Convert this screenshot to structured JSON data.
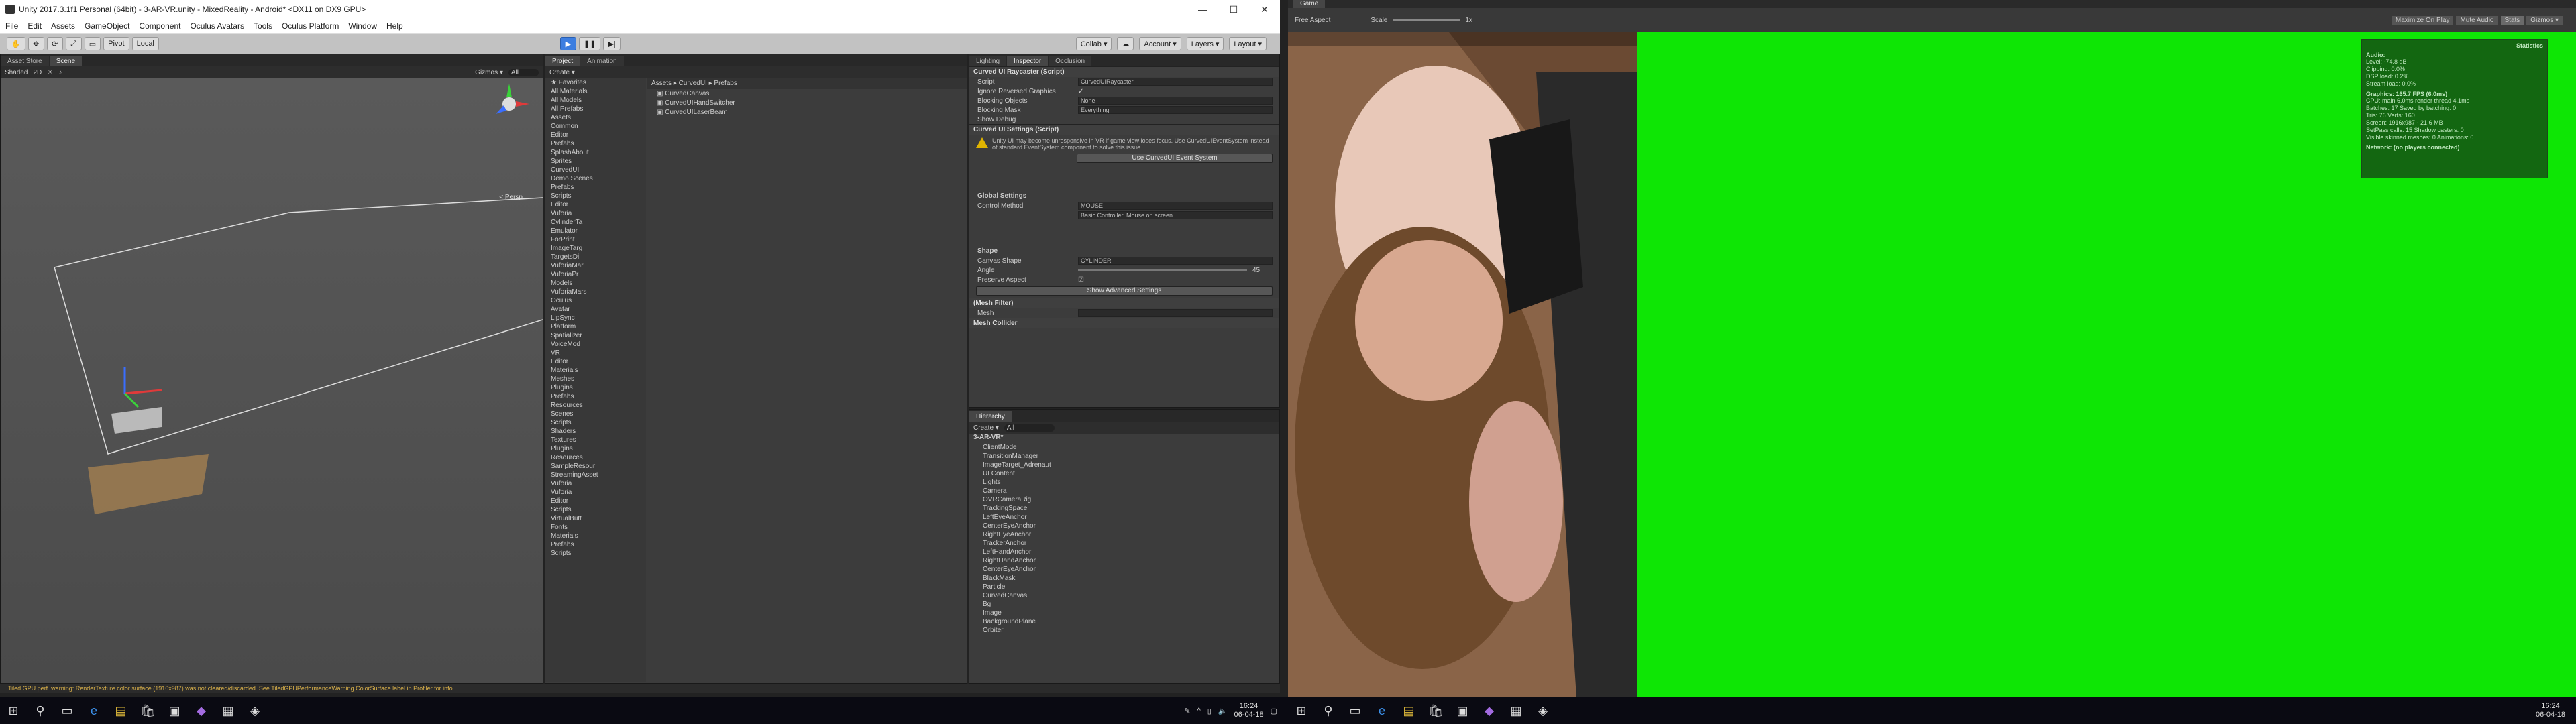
{
  "window": {
    "title": "Unity 2017.3.1f1 Personal (64bit) - 3-AR-VR.unity - MixedReality - Android* <DX11 on DX9 GPU>"
  },
  "menu": [
    "File",
    "Edit",
    "Assets",
    "GameObject",
    "Component",
    "Oculus Avatars",
    "Tools",
    "Oculus Platform",
    "Window",
    "Help"
  ],
  "toolbar": {
    "pivot": "Pivot",
    "local": "Local",
    "collab": "Collab ▾",
    "account": "Account ▾",
    "layers": "Layers ▾",
    "layout": "Layout ▾"
  },
  "scene": {
    "tabs": [
      "Asset Store",
      "Scene"
    ],
    "shading": "Shaded",
    "mode2d": "2D",
    "gizmos": "Gizmos ▾",
    "search": "All",
    "persp": "< Persp"
  },
  "project": {
    "tabs": [
      "Project",
      "Animation"
    ],
    "create": "Create ▾",
    "breadcrumb": "Assets ▸ CurvedUI ▸ Prefabs",
    "tree": [
      "★ Favorites",
      "All Materials",
      "All Models",
      "All Prefabs",
      "Assets",
      "Common",
      "Editor",
      "Prefabs",
      "SplashAbout",
      "Sprites",
      "CurvedUI",
      "Demo Scenes",
      "Prefabs",
      "Scripts",
      "Editor",
      "Vuforia",
      "CylinderTa",
      "Emulator",
      "ForPrint",
      "ImageTarg",
      "TargetsDi",
      "VuforiaMar",
      "VuforiaPr",
      "Models",
      "VuforiaMars",
      "Oculus",
      "Avatar",
      "LipSync",
      "Platform",
      "Spatializer",
      "VoiceMod",
      "VR",
      "Editor",
      "Materials",
      "Meshes",
      "Plugins",
      "Prefabs",
      "Resources",
      "Scenes",
      "Scripts",
      "Shaders",
      "Textures",
      "Plugins",
      "Resources",
      "SampleResour",
      "StreamingAsset",
      "Vuforia",
      "Vuforia",
      "Editor",
      "Scripts",
      "VirtualButt",
      "Fonts",
      "Materials",
      "Prefabs",
      "Scripts"
    ],
    "files": [
      "CurvedCanvas",
      "CurvedUIHandSwitcher",
      "CurvedUILaserBeam"
    ]
  },
  "inspector": {
    "tabs": [
      "Lighting",
      "Inspector",
      "Occlusion"
    ],
    "raycaster": {
      "title": "Curved UI Raycaster (Script)",
      "script_label": "Script",
      "script_val": "CurvedUIRaycaster",
      "props": [
        [
          "Ignore Reversed Graphics",
          "✓"
        ],
        [
          "Blocking Objects",
          "None"
        ],
        [
          "Blocking Mask",
          "Everything"
        ],
        [
          "Show Debug",
          ""
        ]
      ]
    },
    "settings": {
      "title": "Curved UI Settings (Script)",
      "warning": "Unity UI may become unresponsive in VR if game view loses focus. Use CurvedUIEventSystem instead of standard EventSystem component to solve this issue.",
      "use_btn": "Use CurvedUI Event System",
      "global": "Global Settings",
      "control_label": "Control Method",
      "control_val": "MOUSE",
      "control_hint": "Basic Controller. Mouse on screen",
      "shape": "Shape",
      "canvas_shape_label": "Canvas Shape",
      "canvas_shape_val": "CYLINDER",
      "angle_label": "Angle",
      "angle_val": "45",
      "preserve_label": "Preserve Aspect",
      "adv_btn": "Show Advanced Settings"
    },
    "meshfilter": "(Mesh Filter)",
    "mesh_label": "Mesh",
    "meshcollider": "Mesh Collider"
  },
  "hierarchy": {
    "tab": "Hierarchy",
    "create": "Create ▾",
    "search": "All",
    "scene": "3-AR-VR*",
    "items": [
      "ClientMode",
      "TransitionManager",
      "ImageTarget_Adrenaut",
      "UI Content",
      "Lights",
      "Camera",
      "OVRCameraRig",
      "TrackingSpace",
      "LeftEyeAnchor",
      "CenterEyeAnchor",
      "RightEyeAnchor",
      "TrackerAnchor",
      "LeftHandAnchor",
      "RightHandAnchor",
      "CenterEyeAnchor",
      "BlackMask",
      "Particle",
      "CurvedCanvas",
      "Bg",
      "Image",
      "BackgroundPlane",
      "Orbiter"
    ]
  },
  "status": "Tiled GPU perf. warning: RenderTexture color surface (1916x987) was not cleared/discarded. See TiledGPUPerformanceWarning.ColorSurface label in Profiler for info.",
  "taskbar": {
    "time": "16:24",
    "date": "06-04-18"
  },
  "game": {
    "tab": "Game",
    "display": "Free Aspect",
    "scale_label": "Scale",
    "scale_val": "1x",
    "toggles": [
      "Maximize On Play",
      "Mute Audio",
      "Stats",
      "Gizmos ▾"
    ],
    "stats": {
      "title": "Statistics",
      "audio_hd": "Audio:",
      "audio": [
        "Level: -74.8 dB",
        "Clipping: 0.0%",
        "DSP load: 0.2%",
        "Stream load: 0.0%"
      ],
      "graphics_hd": "Graphics:",
      "fps": "165.7 FPS (6.0ms)",
      "graphics": [
        "CPU: main 6.0ms  render thread 4.1ms",
        "Batches: 17   Saved by batching: 0",
        "Tris: 76   Verts: 160",
        "Screen: 1916x987 - 21.6 MB",
        "SetPass calls: 15   Shadow casters: 0",
        "Visible skinned meshes: 0  Animations: 0"
      ],
      "network": "Network: (no players connected)"
    }
  },
  "colors": {
    "green": "#0ee605",
    "play": "#3d7ee0"
  }
}
